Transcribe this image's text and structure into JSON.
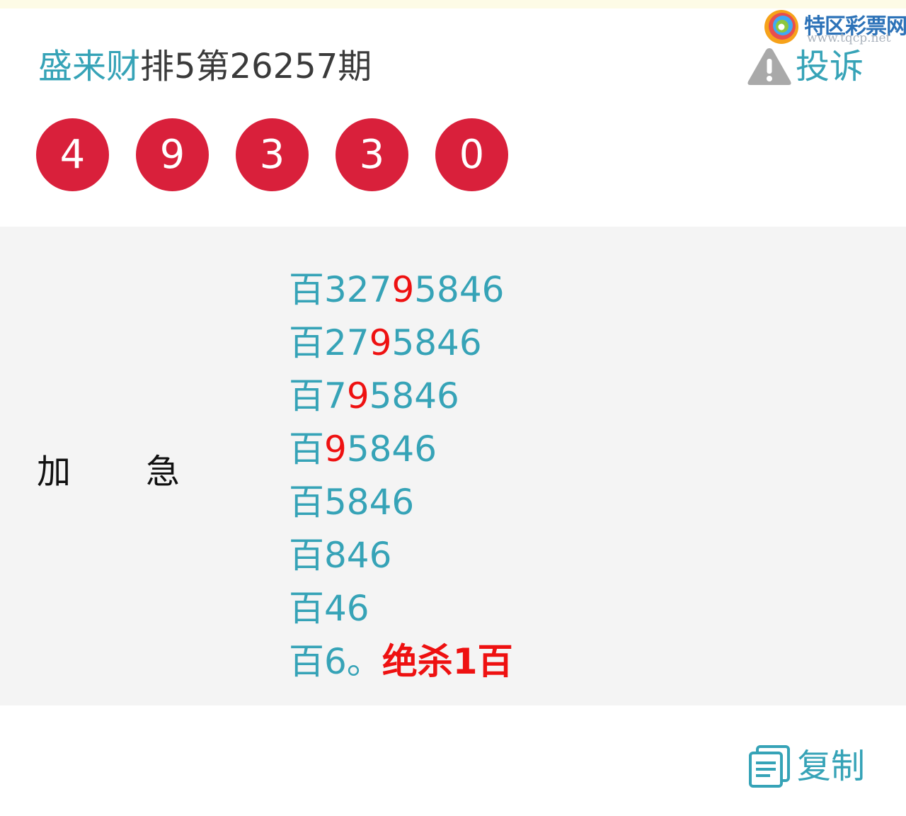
{
  "watermark": {
    "brand": "特区彩票网",
    "url": "www.tqcp.net"
  },
  "header": {
    "name": "盛来财",
    "issue": "排5第26257期"
  },
  "complain": {
    "icon": "warning-triangle-icon",
    "label": "投诉"
  },
  "draw_numbers": [
    "4",
    "9",
    "3",
    "3",
    "0"
  ],
  "panel": {
    "tag_left": "加",
    "tag_right": "急",
    "lines": [
      {
        "prefix": "百327",
        "highlight": "9",
        "rest": "5846"
      },
      {
        "prefix": "百27",
        "highlight": "9",
        "rest": "5846"
      },
      {
        "prefix": "百7",
        "highlight": "9",
        "rest": "5846"
      },
      {
        "prefix": "百",
        "highlight": "9",
        "rest": "5846"
      },
      {
        "prefix": "百5846",
        "highlight": "",
        "rest": ""
      },
      {
        "prefix": "百846",
        "highlight": "",
        "rest": ""
      },
      {
        "prefix": "百46",
        "highlight": "",
        "rest": ""
      },
      {
        "prefix": "百6。",
        "highlight": "",
        "rest": "",
        "kill": "绝杀1百"
      }
    ]
  },
  "copy": {
    "icon": "copy-document-icon",
    "label": "复制"
  },
  "colors": {
    "accent": "#36a3b7",
    "ball": "#d9203b",
    "highlight": "#ee1111",
    "panel_bg": "#f4f4f4"
  }
}
